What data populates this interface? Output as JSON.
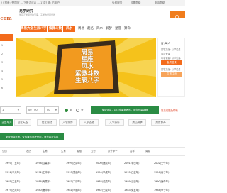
{
  "topbar": {
    "left_text": "!!!搜索:?是国家 … 下是否可以 … 1)中? 现: 方用户",
    "items": [
      "免费服务",
      "设置帮助",
      "电话帮助"
    ],
    "right": [
      "这里是账号",
      "开出",
      "阅读"
    ]
  },
  "header": {
    "logo": ".com",
    "brand_title": "易学研究",
    "brand_sub": "你真正学易学的宝库，子学的学易学的",
    "search_placeholder": ""
  },
  "nav": {
    "tabs": [
      "周易大全",
      "生辰八字",
      "紫微斗数",
      "风水"
    ],
    "links": [
      "周易",
      "起名",
      "风水",
      "解梦",
      "星座",
      "算命"
    ]
  },
  "left_menu": [
    "",
    "1",
    "2",
    "3",
    "4",
    "5",
    "6"
  ],
  "banner": {
    "lines": [
      "周易",
      "星座",
      "风水",
      "紫微斗数",
      "生辰八字"
    ]
  },
  "right_panel": {
    "title": "吉, 每人",
    "lines": [
      "易学文化: 以学论易",
      "会员登录",
      "以学论易: 以学论易",
      "易学文化: 以学论易"
    ],
    "buttons": [
      "会员登录",
      "立即注册"
    ]
  },
  "form": {
    "date_value": "1",
    "time_value": "00 : 00",
    "hour_value": "00",
    "radio_male": "男",
    "radio_female": "女",
    "submit_label": "免费测算，以往结果参考的，请您尽量详细",
    "link_label": "常见问题及帮助"
  },
  "tabs2": [
    "出生年月",
    "起名大全",
    "姓名测试",
    "八字测算",
    "八字合婚",
    "八字分析",
    "周公解梦",
    "周易算命"
  ],
  "info_button": "免费测算页面，仅供娱乐参考使用，请您留意保存",
  "tabs3": [
    "公历",
    "农历",
    "生肖",
    "生肖",
    "属相",
    "五行",
    "六十甲子",
    "吉祥",
    "周易"
  ],
  "table": [
    [
      "1997(丁丑年)",
      "1998(戊寅年)",
      "1999(己卯年)",
      "2000(庚辰年)",
      "2001(辛巳年)",
      "2002(壬午年)"
    ],
    [
      "1991(辛未年)",
      "1992(壬申年)",
      "1993(癸酉年)",
      "1994(甲戌年)",
      "1995(乙亥年)",
      "1996(丙子年)"
    ],
    [
      "1985(乙丑年)",
      "1986(丙寅年)",
      "1987(丁卯年)",
      "1988(戊辰年)",
      "1989(己巳年)",
      "1990(庚午年)"
    ],
    [
      "1979(己未年)",
      "1980(庚申年)",
      "1981(辛酉年)",
      "1982(壬戌年)",
      "1983(癸亥年)",
      "1984(甲子年)"
    ]
  ],
  "colors": {
    "accent": "#f36b1c",
    "green": "#2a8c44",
    "banner": "#f5c21b"
  }
}
